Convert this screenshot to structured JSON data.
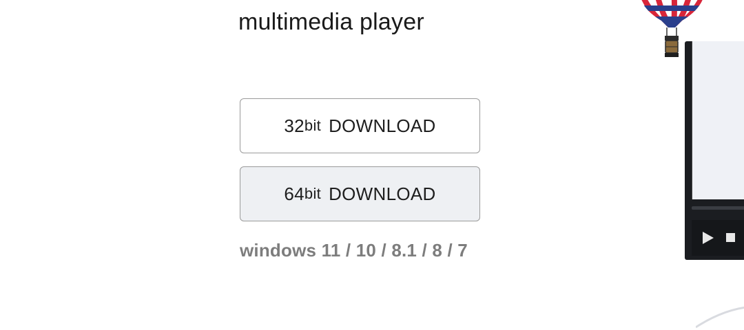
{
  "header": {
    "subtitle": "multimedia player"
  },
  "downloads": {
    "btn32": {
      "bits": "32",
      "suffix": "bit",
      "label": "DOWNLOAD"
    },
    "btn64": {
      "bits": "64",
      "suffix": "bit",
      "label": "DOWNLOAD"
    }
  },
  "os_support": "windows 11 / 10 / 8.1 / 8 / 7",
  "colors": {
    "button_border": "#9a9a9a",
    "button64_bg": "#eef0f3",
    "os_text": "#7d7d7d",
    "balloon_red": "#d8263a",
    "balloon_blue": "#2a3f8c"
  },
  "icons": {
    "play": "play-icon",
    "stop": "stop-icon",
    "balloon": "hot-air-balloon-icon"
  }
}
